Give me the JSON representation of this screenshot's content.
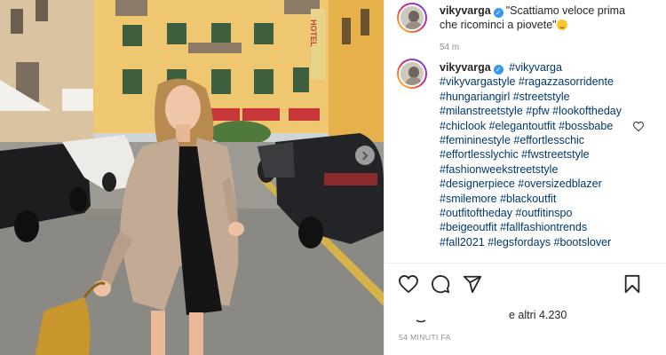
{
  "post": {
    "username": "vikyvarga",
    "caption": "\"Scattiamo veloce prima che ricominci a piovete\"",
    "caption_time": "54 m",
    "hashtag_username": "vikyvarga",
    "hashtags_first": "#vikyvarga",
    "hashtags": "#vikyvargastyle #ragazzasorridente #hungariangirl #streetstyle #milanstreetstyle #pfw #lookoftheday #chiclook #elegantoutfit #bossbabe #femininestyle #effortlesschic #effortlesslychic #fwstreetstyle #fashionweekstreetstyle #designerpiece #oversizedblazer #smilemore #blackoutfit #outfitoftheday #outfitinspo #beigeoutfit #fallfashiontrends #fall2021 #legsfordays #bootslover",
    "likes_text": "e altri 4.230",
    "posted_time": "54 MINUTI FA"
  },
  "photo": {
    "sign_text": "HOTEL"
  },
  "icons": {
    "verified": "✓",
    "like": "heart-icon",
    "comment": "comment-icon",
    "share": "paper-plane-icon",
    "save": "bookmark-icon"
  },
  "colors": {
    "hashtag": "#00376b",
    "verified": "#3897f0",
    "muted": "#8e8e8e"
  }
}
